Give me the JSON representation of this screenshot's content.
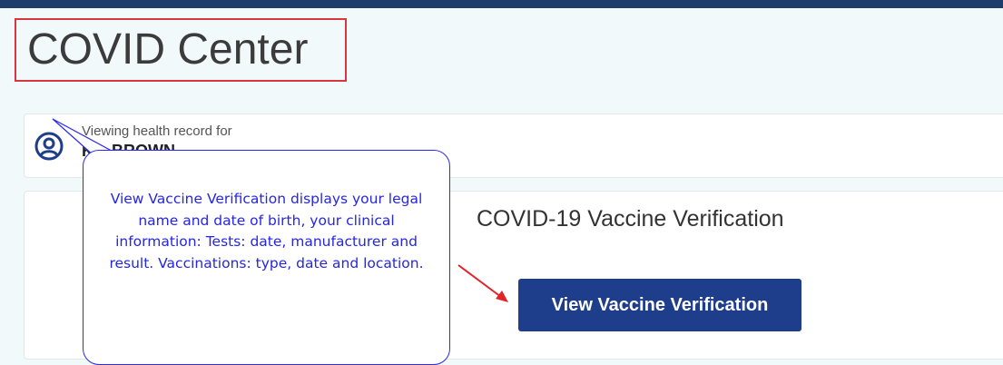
{
  "page": {
    "title": "COVID Center"
  },
  "record": {
    "label": "Viewing health record for",
    "name": "K... BROWN",
    "avatar_icon": "user-circle-icon"
  },
  "vaccine": {
    "title": "COVID-19 Vaccine Verification",
    "button_label": "View Vaccine Verification"
  },
  "annotation": {
    "callout_text": "View Vaccine Verification displays your legal name and date of birth, your clinical information: Tests: date, manufacturer and result.  Vaccinations: type, date and location.",
    "highlight_color": "#d9363e",
    "callout_color": "#2a2af0"
  },
  "colors": {
    "header_bar": "#1e3d6b",
    "background": "#f2f9fa",
    "button": "#1e3e8c"
  }
}
